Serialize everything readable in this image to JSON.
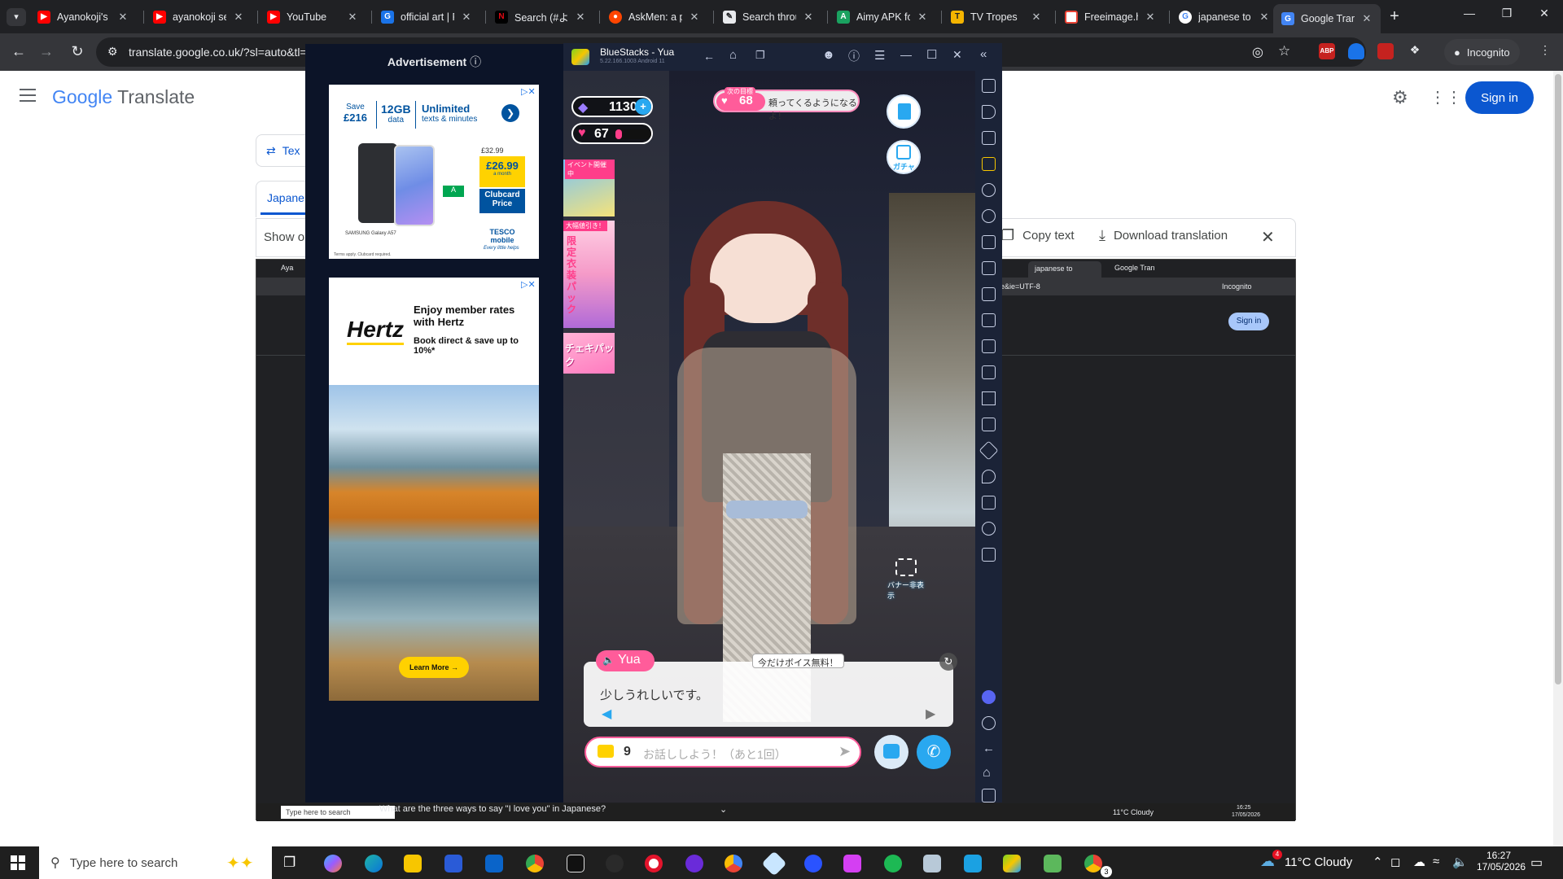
{
  "browser": {
    "tabs": [
      {
        "title": "Ayanokoji's a",
        "icon": "youtube-icon"
      },
      {
        "title": "ayanokoji se",
        "icon": "youtube-icon"
      },
      {
        "title": "YouTube",
        "icon": "youtube-icon"
      },
      {
        "title": "official art | F",
        "icon": "fandom-icon"
      },
      {
        "title": "Search (#よう",
        "icon": "netflix-icon"
      },
      {
        "title": "AskMen: a p",
        "icon": "reddit-icon"
      },
      {
        "title": "Search throu",
        "icon": "doc-icon"
      },
      {
        "title": "Aimy APK fo",
        "icon": "aimy-icon"
      },
      {
        "title": "TV Tropes",
        "icon": "tvtropes-icon"
      },
      {
        "title": "Freeimage.h",
        "icon": "freeimage-icon"
      },
      {
        "title": "japanese to",
        "icon": "google-icon"
      },
      {
        "title": "Google Trans",
        "icon": "google-translate-icon",
        "active": true
      }
    ],
    "url": "translate.google.co.uk/?sl=auto&tl=",
    "incognito_label": "Incognito"
  },
  "translate": {
    "logo_google": "Google",
    "logo_translate": "Translate",
    "signin": "Sign in",
    "text_tab": "Tex",
    "lang_tab": "Japane",
    "show_more": "Show o",
    "copy_text": "Copy text",
    "download_translation": "Download translation",
    "question": "What are the three ways to say \"I love you\" in Japanese?"
  },
  "inner": {
    "tabs": [
      "Aya",
      "japanese to",
      "Google Tran"
    ],
    "url_tail": "e&ie=UTF-8",
    "incognito": "Incognito",
    "signin": "Sign in",
    "taskbar_search": "Type here to search",
    "weather": "11°C Cloudy",
    "time": "16:25",
    "date": "17/05/2026"
  },
  "ads": {
    "header": "Advertisement",
    "ad1": {
      "save_line1": "Save",
      "save_line2": "£216",
      "data_amt": "12GB",
      "data_label": "data",
      "unlimited": "Unlimited",
      "unlimited_sub": "texts & minutes",
      "price_old": "£32.99",
      "price_new": "£26.99",
      "price_sub": "a month",
      "clubcard": "Clubcard Price",
      "phone": "SAMSUNG Galaxy A57",
      "brand": "TESCO mobile",
      "brand_tag": "Every little helps",
      "terms": "Terms apply. Clubcard required."
    },
    "ad2": {
      "brand": "Hertz",
      "headline": "Enjoy member rates with Hertz",
      "sub": "Book direct & save up to 10%*",
      "cta": "Learn More"
    }
  },
  "bluestacks": {
    "title": "BlueStacks - Yua",
    "version": "5.22.166.1003 Android 11",
    "gems": "1130",
    "hearts": "67",
    "next_goal_label": "次の目標",
    "next_goal_value": "68",
    "next_goal_text": "頼ってくるようになるよ！",
    "gacha": "ガチャ",
    "event_label": "イベント開催中",
    "discount_label": "大幅値引き！",
    "costume_label": "限定衣装パック",
    "pack_label": "チェキパック",
    "banner_hide": "バナー非表示",
    "speaker": "Yua",
    "voice_free": "今だけボイス無料！",
    "dialogue": "少しうれしいです。",
    "chat_count": "9",
    "chat_placeholder": "お話ししよう！（あと1回）"
  },
  "taskbar": {
    "search_placeholder": "Type here to search",
    "weather_temp": "11°C",
    "weather_desc": "Cloudy",
    "time": "16:27",
    "date": "17/05/2026",
    "notif": "3",
    "badge": "4"
  }
}
